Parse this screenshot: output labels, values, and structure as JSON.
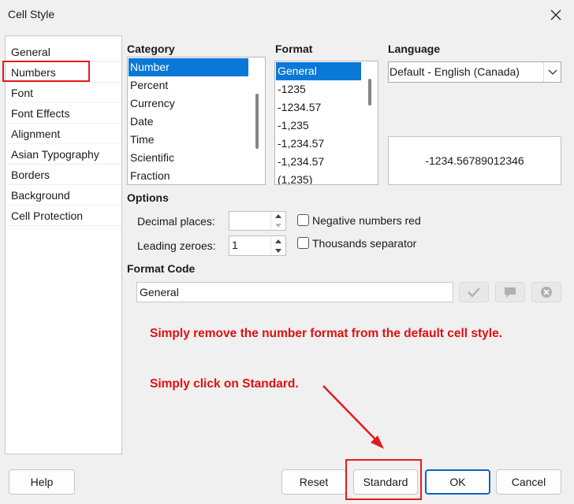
{
  "window": {
    "title": "Cell Style"
  },
  "sidebar": {
    "items": [
      {
        "label": "General"
      },
      {
        "label": "Numbers"
      },
      {
        "label": "Font"
      },
      {
        "label": "Font Effects"
      },
      {
        "label": "Alignment"
      },
      {
        "label": "Asian Typography"
      },
      {
        "label": "Borders"
      },
      {
        "label": "Background"
      },
      {
        "label": "Cell Protection"
      }
    ],
    "selected": "Numbers"
  },
  "category": {
    "heading": "Category",
    "items": [
      "Number",
      "Percent",
      "Currency",
      "Date",
      "Time",
      "Scientific",
      "Fraction"
    ],
    "selected": "Number"
  },
  "format": {
    "heading": "Format",
    "items": [
      "General",
      "-1235",
      "-1234.57",
      "-1,235",
      "-1,234.57",
      "-1,234.57",
      "(1,235)"
    ],
    "selected": "General"
  },
  "language": {
    "heading": "Language",
    "value": "Default - English (Canada)"
  },
  "preview": {
    "value": "-1234.56789012346"
  },
  "options": {
    "heading": "Options",
    "decimal_label": "Decimal places:",
    "decimal_value": "",
    "leading_label": "Leading zeroes:",
    "leading_value": "1",
    "negative_red_label": "Negative numbers red",
    "negative_red_checked": false,
    "thousands_label": "Thousands separator",
    "thousands_checked": false
  },
  "format_code": {
    "heading": "Format Code",
    "value": "General"
  },
  "annotation": {
    "line1": "Simply remove the number format from the default cell style.",
    "line2": "Simply click on Standard."
  },
  "buttons": {
    "help": "Help",
    "reset": "Reset",
    "standard": "Standard",
    "ok": "OK",
    "cancel": "Cancel"
  },
  "colors": {
    "accent": "#0a78d7",
    "annotation": "#e01010"
  }
}
